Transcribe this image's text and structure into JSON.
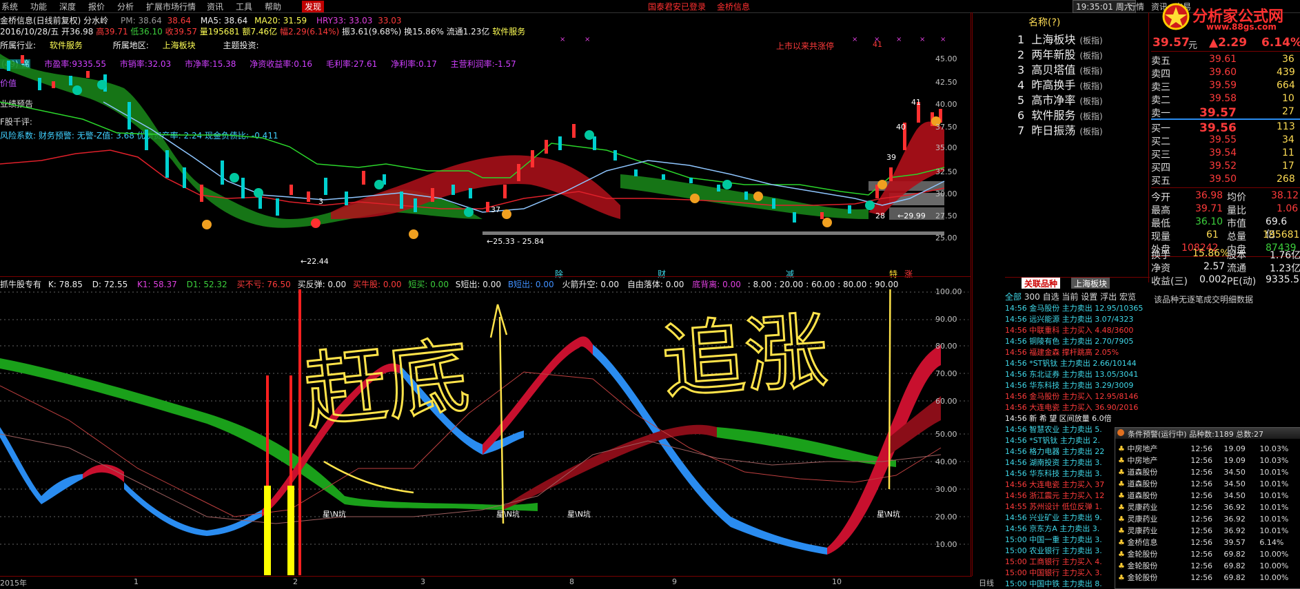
{
  "menu": {
    "items": [
      "系统",
      "功能",
      "深度",
      "报价",
      "分析",
      "扩展市场行情",
      "资讯",
      "工具",
      "帮助",
      "发现"
    ],
    "active": "发现",
    "notice1": "国泰君安已登录",
    "notice2": "金桥信息",
    "clock": "19:35:01 周六",
    "right_items": [
      "行情",
      "资讯",
      "交易"
    ]
  },
  "brand": {
    "logo_text": "分析家公式网",
    "url": "www.88gs.com"
  },
  "header": {
    "title": "金桥信息(日线前复权) 分水岭",
    "pm": "PM: 38.64",
    "pm2": "38.64",
    "ma5": "MA5: 38.64",
    "ma20": "MA20: 31.59",
    "hry33": "HRY33: 33.03",
    "hry33b": "33.03",
    "date": "2016/10/28/五",
    "open": "开36.98",
    "high": "高39.71",
    "low": "低36.10",
    "close": "收39.57",
    "vol": "量195681",
    "amount": "额7.46亿",
    "chg": "幅2.29(6.14%)",
    "amp": "振3.61(9.68%)",
    "turnover": "换15.86%",
    "float": "流通1.23亿",
    "sector": "软件服务",
    "industry_label": "所属行业:",
    "industry": "软件服务",
    "region_label": "所属地区:",
    "region": "上海板块",
    "theme_label": "主题投资:",
    "ratios": [
      "市盈率:9335.55",
      "市销率:32.03",
      "市净率:15.38",
      "净资收益率:0.16",
      "毛利率:27.61",
      "净利率:0.17",
      "主营利润率:-1.57"
    ],
    "left_tags": [
      "(49) 锦",
      "价值",
      "业绩预告",
      "F股千评:"
    ],
    "risk": "风险系数: 财务预警: 无警-Z值: 3.68 优质资产率: 2.24 现金负债比: -0.411",
    "since_ipo": "上市以来共涨停",
    "since_ipo_count": "41"
  },
  "main_axis": [
    "45.00",
    "42.50",
    "40.00",
    "37.50",
    "35.00",
    "32.50",
    "30.00",
    "27.50",
    "25.00"
  ],
  "main_annotations": {
    "low1": "22.44",
    "range": "25.33 - 25.84",
    "lvl37": "37",
    "lvl39": "39",
    "lvl40": "40",
    "lvl41": "41",
    "lvl28": "28",
    "lvl2999": "29.99",
    "lvl3": "3"
  },
  "event_marks": [
    "除",
    "财",
    "减",
    "特",
    "涨"
  ],
  "indicator_header": {
    "name": "抓牛股专有",
    "k": "K: 78.85",
    "d": "D: 72.55",
    "k1": "K1: 58.37",
    "d1": "D1: 52.32",
    "buy_not_lose": "买不亏: 76.50",
    "buy_rebound": "买反弹: 0.00",
    "buy_bull": "买牛股: 0.00",
    "short_buy": "短买: 0.00",
    "s_short": "S短出: 0.00",
    "b_short": "B短出: 0.00",
    "rocket": "火箭升空: 0.00",
    "free_fall": "自由落体: 0.00",
    "bottom": "底背离: 0.00",
    "levels": ": 8.00 : 20.00 : 60.00 : 80.00 : 90.00"
  },
  "ind_axis": [
    "100.00",
    "90.00",
    "80.00",
    "70.00",
    "60.00",
    "50.00",
    "40.00",
    "30.00",
    "20.00",
    "10.00"
  ],
  "ind_labels": [
    "星\\N坑",
    "星\\N坑",
    "星\\N坑",
    "星\\N坑"
  ],
  "handwriting": {
    "left": "赶底",
    "right": "追涨"
  },
  "xaxis": {
    "labels": [
      "2015年",
      "1",
      "2",
      "3",
      "8",
      "9",
      "10"
    ],
    "period": "日线"
  },
  "sector_list": {
    "header": "名称(?)",
    "rows": [
      {
        "n": "1",
        "name": "上海板块",
        "tag": "(板指)"
      },
      {
        "n": "2",
        "name": "两年新股",
        "tag": "(板指)"
      },
      {
        "n": "3",
        "name": "高贝塔值",
        "tag": "(板指)"
      },
      {
        "n": "4",
        "name": "昨高换手",
        "tag": "(板指)"
      },
      {
        "n": "5",
        "name": "高市净率",
        "tag": "(板指)"
      },
      {
        "n": "6",
        "name": "软件服务",
        "tag": "(板指)"
      },
      {
        "n": "7",
        "name": "昨日振荡",
        "tag": "(板指)"
      }
    ]
  },
  "quote": {
    "price": "39.57",
    "unit": "元",
    "chg": "▲2.29",
    "pct": "6.14%",
    "asks": [
      {
        "label": "卖五",
        "price": "39.61",
        "vol": "36"
      },
      {
        "label": "卖四",
        "price": "39.60",
        "vol": "439"
      },
      {
        "label": "卖三",
        "price": "39.59",
        "vol": "664"
      },
      {
        "label": "卖二",
        "price": "39.58",
        "vol": "10"
      },
      {
        "label": "卖一",
        "price": "39.57",
        "vol": "27"
      }
    ],
    "bids": [
      {
        "label": "买一",
        "price": "39.56",
        "vol": "113"
      },
      {
        "label": "买二",
        "price": "39.55",
        "vol": "34"
      },
      {
        "label": "买三",
        "price": "39.54",
        "vol": "11"
      },
      {
        "label": "买四",
        "price": "39.52",
        "vol": "17"
      },
      {
        "label": "买五",
        "price": "39.50",
        "vol": "268"
      }
    ],
    "stats": [
      {
        "a": "今开",
        "b": "36.98",
        "c": "均价",
        "d": "38.12"
      },
      {
        "a": "最高",
        "b": "39.71",
        "c": "量比",
        "d": "1.06"
      },
      {
        "a": "最低",
        "b": "36.10",
        "c": "市值",
        "d": "69.6亿"
      },
      {
        "a": "现量",
        "b": "61",
        "c": "总量",
        "d": "195681"
      },
      {
        "a": "外盘",
        "b": "108242",
        "c": "内盘",
        "d": "87439"
      },
      {
        "a": "换手",
        "b": "15.86%",
        "c": "股本",
        "d": "1.76亿"
      },
      {
        "a": "净资",
        "b": "2.57",
        "c": "流通",
        "d": "1.23亿"
      },
      {
        "a": "收益(三)",
        "b": "0.002",
        "c": "PE(动)",
        "d": "9335.5"
      }
    ],
    "no_detail": "该品种无逐笔成交明细数据"
  },
  "tabs": {
    "t1": "关联品种",
    "t2": "上海板块"
  },
  "filter": [
    "全部",
    "300",
    "自选",
    "当前",
    "设置",
    "浮出",
    "宏览"
  ],
  "ticks": [
    {
      "t": "14:56",
      "n": "金马股份",
      "a": "主力卖出",
      "v": "12.95/10365",
      "c": "cyan"
    },
    {
      "t": "14:56",
      "n": "远兴能源",
      "a": "主力卖出",
      "v": "3.07/4323",
      "c": "cyan"
    },
    {
      "t": "14:56",
      "n": "中联重科",
      "a": "主力买入",
      "v": "4.48/3600",
      "c": "red"
    },
    {
      "t": "14:56",
      "n": "铜陵有色",
      "a": "主力卖出",
      "v": "2.70/7905",
      "c": "cyan"
    },
    {
      "t": "14:56",
      "n": "福建金森",
      "a": "撑杆跳高",
      "v": "2.05%",
      "c": "red"
    },
    {
      "t": "14:56",
      "n": "*ST钒钛",
      "a": "主力卖出",
      "v": "2.66/10144",
      "c": "cyan"
    },
    {
      "t": "14:56",
      "n": "东北证券",
      "a": "主力卖出",
      "v": "13.05/3041",
      "c": "cyan"
    },
    {
      "t": "14:56",
      "n": "华东科技",
      "a": "主力卖出",
      "v": "3.29/3009",
      "c": "cyan"
    },
    {
      "t": "14:56",
      "n": "金马股份",
      "a": "主力买入",
      "v": "12.95/8146",
      "c": "red"
    },
    {
      "t": "14:56",
      "n": "大连电瓷",
      "a": "主力买入",
      "v": "36.90/2016",
      "c": "red"
    },
    {
      "t": "14:56",
      "n": "新 希 望",
      "a": "区间放量",
      "v": "6.0倍",
      "c": "white"
    },
    {
      "t": "14:56",
      "n": "智慧农业",
      "a": "主力卖出",
      "v": "5.",
      "c": "cyan"
    },
    {
      "t": "14:56",
      "n": "*ST钒钛",
      "a": "主力卖出",
      "v": "2.",
      "c": "cyan"
    },
    {
      "t": "14:56",
      "n": "格力电器",
      "a": "主力卖出",
      "v": "22",
      "c": "cyan"
    },
    {
      "t": "14:56",
      "n": "湖南投资",
      "a": "主力卖出",
      "v": "3.",
      "c": "cyan"
    },
    {
      "t": "14:56",
      "n": "华东科技",
      "a": "主力卖出",
      "v": "3.",
      "c": "cyan"
    },
    {
      "t": "14:56",
      "n": "大连电瓷",
      "a": "主力买入",
      "v": "37",
      "c": "red"
    },
    {
      "t": "14:56",
      "n": "浙江震元",
      "a": "主力买入",
      "v": "12",
      "c": "red"
    },
    {
      "t": "14:55",
      "n": "苏州设计",
      "a": "低位反弹",
      "v": "1.",
      "c": "red"
    },
    {
      "t": "14:56",
      "n": "兴业矿业",
      "a": "主力卖出",
      "v": "9.",
      "c": "cyan"
    },
    {
      "t": "14:56",
      "n": "京东方A",
      "a": "主力卖出",
      "v": "3.",
      "c": "cyan"
    },
    {
      "t": "15:00",
      "n": "中国一重",
      "a": "主力卖出",
      "v": "3.",
      "c": "cyan"
    },
    {
      "t": "15:00",
      "n": "农业银行",
      "a": "主力卖出",
      "v": "3.",
      "c": "cyan"
    },
    {
      "t": "15:00",
      "n": "工商银行",
      "a": "主力买入",
      "v": "4.",
      "c": "red"
    },
    {
      "t": "15:00",
      "n": "中国银行",
      "a": "主力买入",
      "v": "3.",
      "c": "red"
    },
    {
      "t": "15:00",
      "n": "中国中铁",
      "a": "主力卖出",
      "v": "8.",
      "c": "cyan"
    }
  ],
  "cond_panel": {
    "title": "条件预警(运行中) 品种数:1189 总数:27",
    "rows": [
      {
        "n": "中房地产",
        "t": "12:56",
        "p": "19.09",
        "c": "10.03%"
      },
      {
        "n": "中房地产",
        "t": "12:56",
        "p": "19.09",
        "c": "10.03%"
      },
      {
        "n": "道森股份",
        "t": "12:56",
        "p": "34.50",
        "c": "10.01%"
      },
      {
        "n": "道森股份",
        "t": "12:56",
        "p": "34.50",
        "c": "10.01%"
      },
      {
        "n": "道森股份",
        "t": "12:56",
        "p": "34.50",
        "c": "10.01%"
      },
      {
        "n": "灵康药业",
        "t": "12:56",
        "p": "36.92",
        "c": "10.01%"
      },
      {
        "n": "灵康药业",
        "t": "12:56",
        "p": "36.92",
        "c": "10.01%"
      },
      {
        "n": "灵康药业",
        "t": "12:56",
        "p": "36.92",
        "c": "10.01%"
      },
      {
        "n": "金桥信息",
        "t": "12:56",
        "p": "39.57",
        "c": "6.14%"
      },
      {
        "n": "金轮股份",
        "t": "12:56",
        "p": "69.82",
        "c": "10.00%"
      },
      {
        "n": "金轮股份",
        "t": "12:56",
        "p": "69.82",
        "c": "10.00%"
      },
      {
        "n": "金轮股份",
        "t": "12:56",
        "p": "69.82",
        "c": "10.00%"
      }
    ]
  },
  "colors": {
    "up": "#ff3b3b",
    "down": "#00c8c8",
    "band_red": "#c8102e",
    "band_green": "#1aa01a",
    "band_blue": "#2a8cf0",
    "hand": "#ffe34a"
  }
}
